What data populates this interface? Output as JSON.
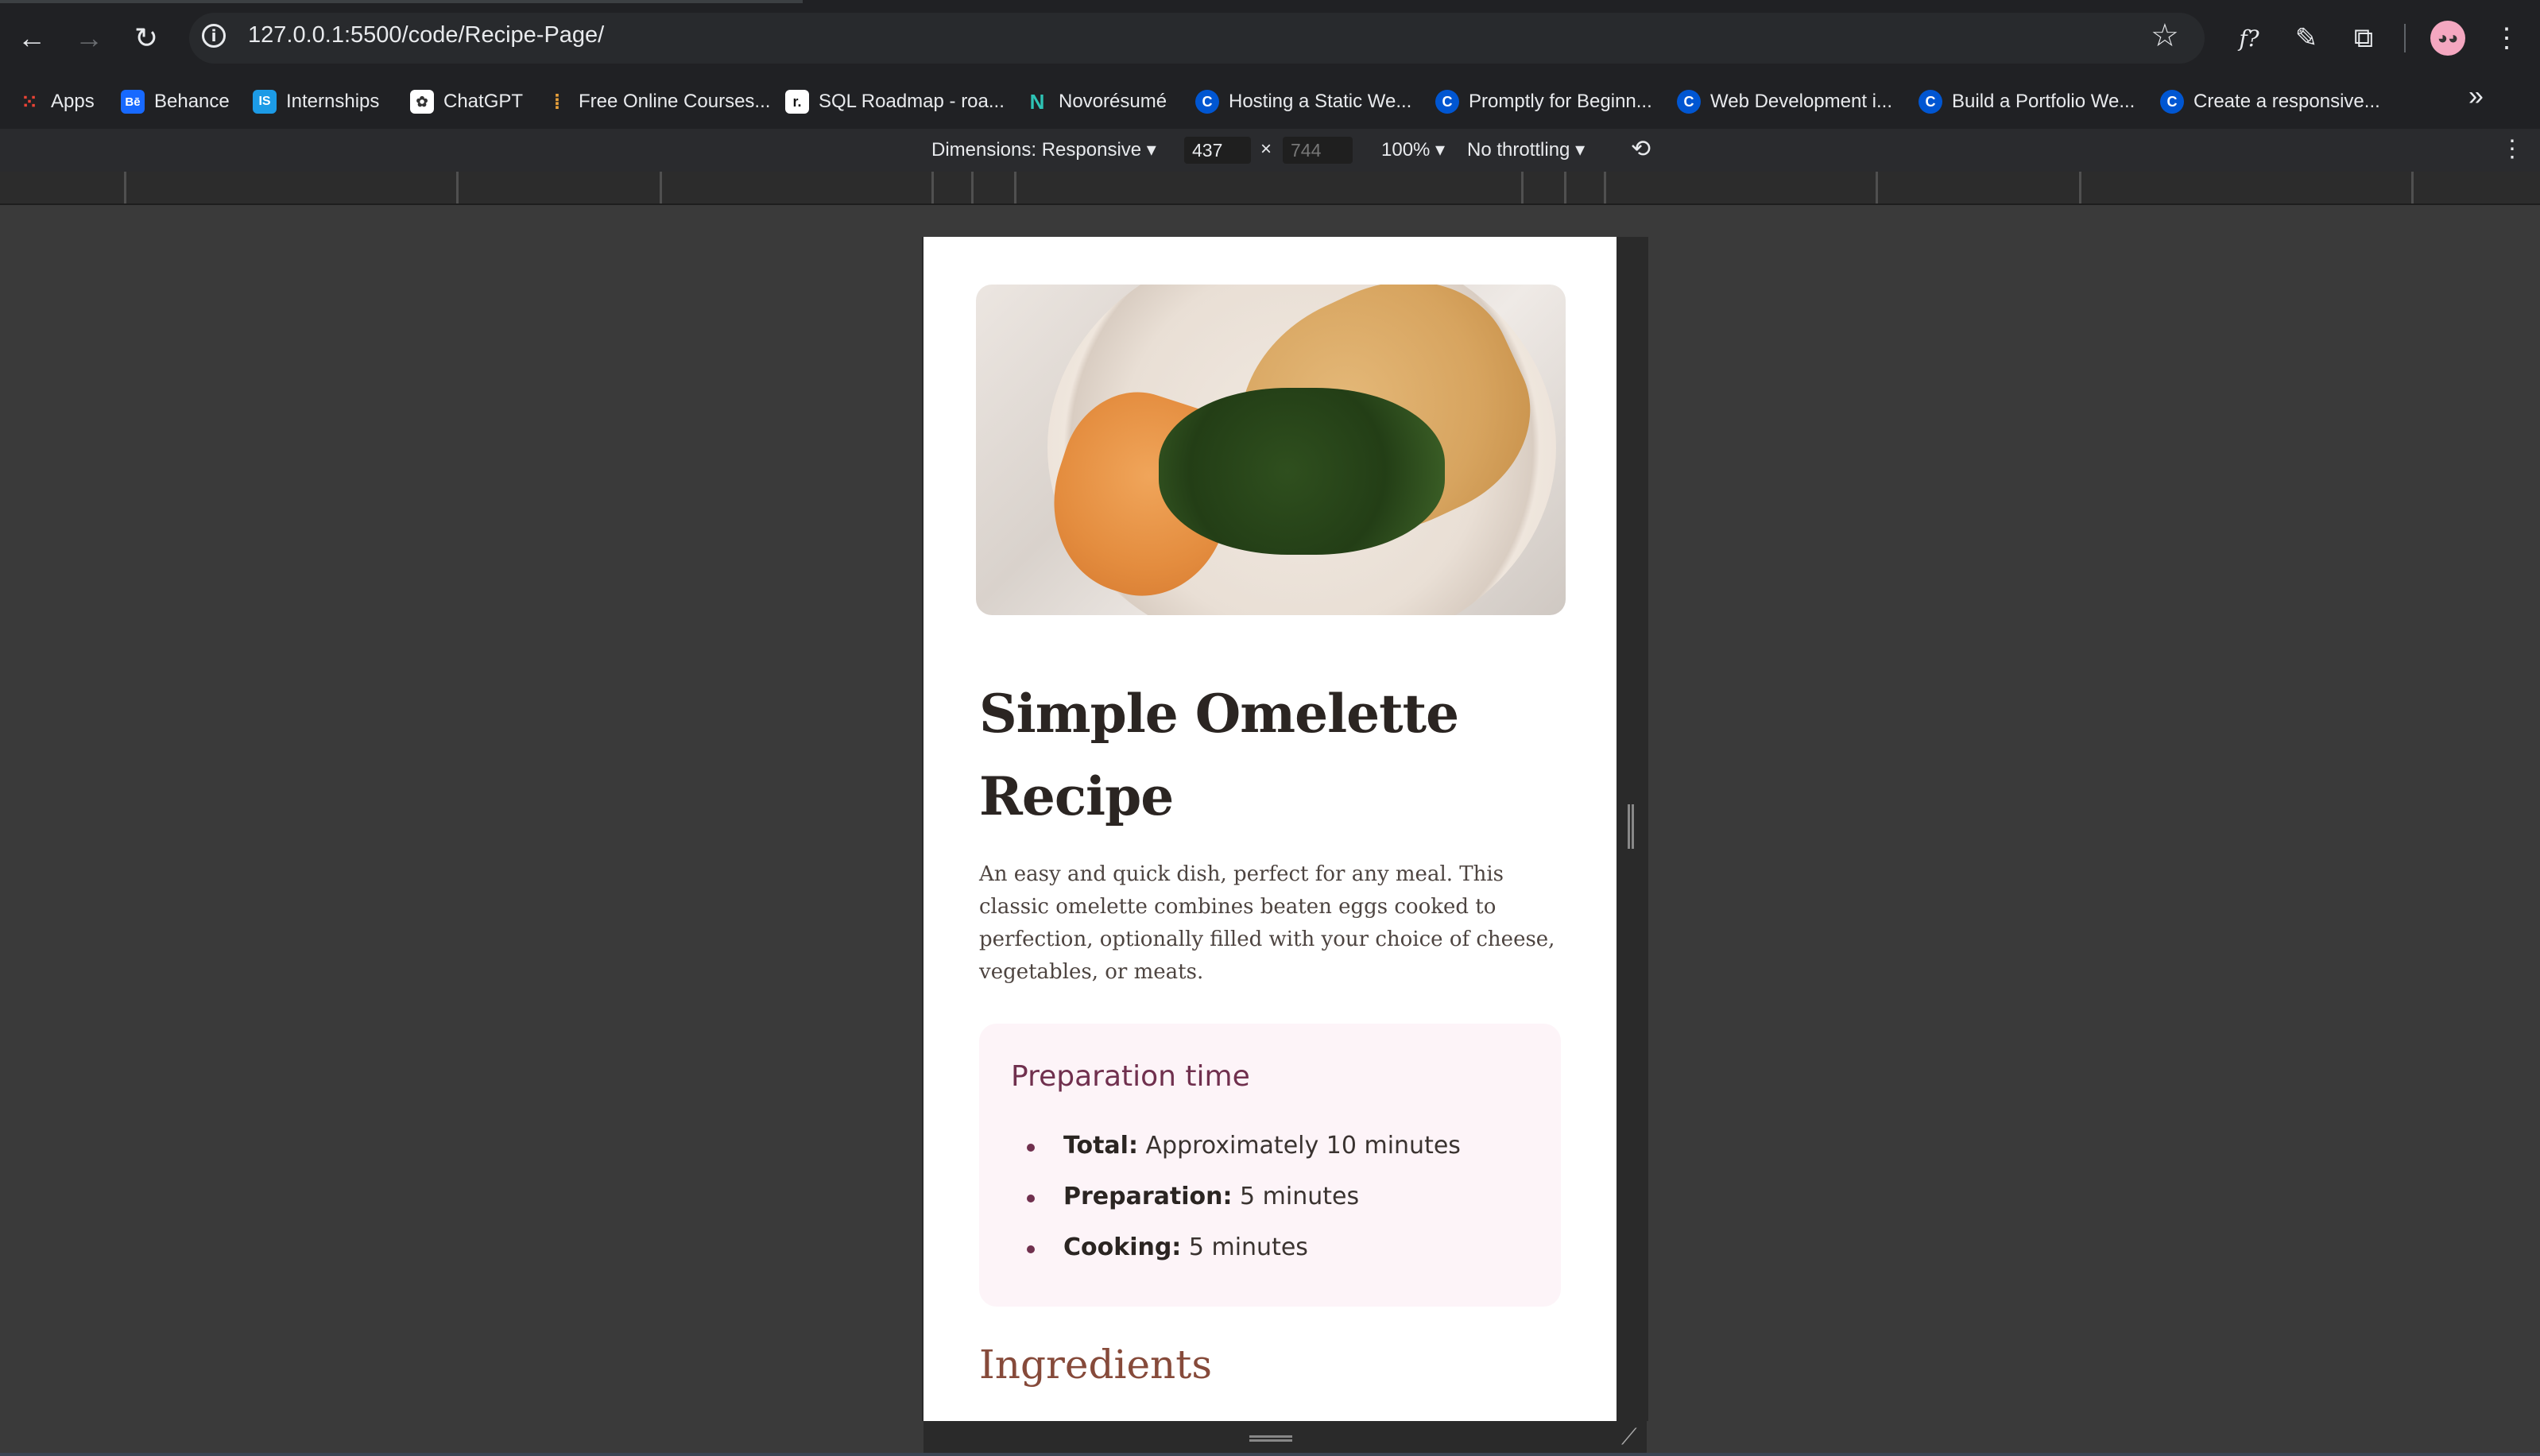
{
  "browser": {
    "url": "127.0.0.1:5500/code/Recipe-Page/",
    "nav": {
      "back_icon": "←",
      "forward_icon": "→",
      "reload_icon": "↻"
    },
    "toolbar_icons": {
      "font_icon": "f?",
      "eyedropper_icon": "✎",
      "extensions_icon": "⧉",
      "menu_icon": "⋮"
    }
  },
  "bookmarks": [
    {
      "label": "Apps",
      "icon": "apps-grid-icon",
      "glyph": "",
      "color": "#4285f4"
    },
    {
      "label": "Behance",
      "icon": "behance-icon",
      "glyph": "Bē",
      "color": "#1769ff"
    },
    {
      "label": "Internships",
      "icon": "internshala-icon",
      "glyph": "IS",
      "color": "#1c9be6"
    },
    {
      "label": "ChatGPT",
      "icon": "chatgpt-icon",
      "glyph": "✿",
      "color": "#444"
    },
    {
      "label": "Free Online Courses...",
      "icon": "courses-icon",
      "glyph": "⁞",
      "color": "#e9a13b"
    },
    {
      "label": "SQL Roadmap - roa...",
      "icon": "roadmap-icon",
      "glyph": "r.",
      "color": "#111"
    },
    {
      "label": "Novorésumé",
      "icon": "novoresume-icon",
      "glyph": "N",
      "color": "#2ec4b6"
    },
    {
      "label": "Hosting a Static We...",
      "icon": "coursera-icon",
      "glyph": "C",
      "color": "#0056d2"
    },
    {
      "label": "Promptly for Beginn...",
      "icon": "coursera-icon",
      "glyph": "C",
      "color": "#0056d2"
    },
    {
      "label": "Web Development i...",
      "icon": "coursera-icon",
      "glyph": "C",
      "color": "#0056d2"
    },
    {
      "label": "Build a Portfolio We...",
      "icon": "coursera-icon",
      "glyph": "C",
      "color": "#0056d2"
    },
    {
      "label": "Create a responsive...",
      "icon": "coursera-icon",
      "glyph": "C",
      "color": "#0056d2"
    }
  ],
  "devtools": {
    "dimensions_label": "Dimensions: Responsive",
    "width": "437",
    "times": "×",
    "height": "744",
    "zoom": "100%",
    "throttling": "No throttling"
  },
  "recipe": {
    "title": "Simple Omelette Recipe",
    "intro": "An easy and quick dish, perfect for any meal. This classic omelette combines beaten eggs cooked to perfection, optionally filled with your choice of cheese, vegetables, or meats.",
    "preparation": {
      "heading": "Preparation time",
      "items": [
        {
          "label": "Total:",
          "value": "Approximately 10 minutes"
        },
        {
          "label": "Preparation:",
          "value": "5 minutes"
        },
        {
          "label": "Cooking:",
          "value": "5 minutes"
        }
      ]
    },
    "ingredients_heading": "Ingredients"
  },
  "colors": {
    "accent_plum": "#70304e",
    "accent_brown": "#864a3a",
    "prep_bg": "#fdf4f8"
  }
}
